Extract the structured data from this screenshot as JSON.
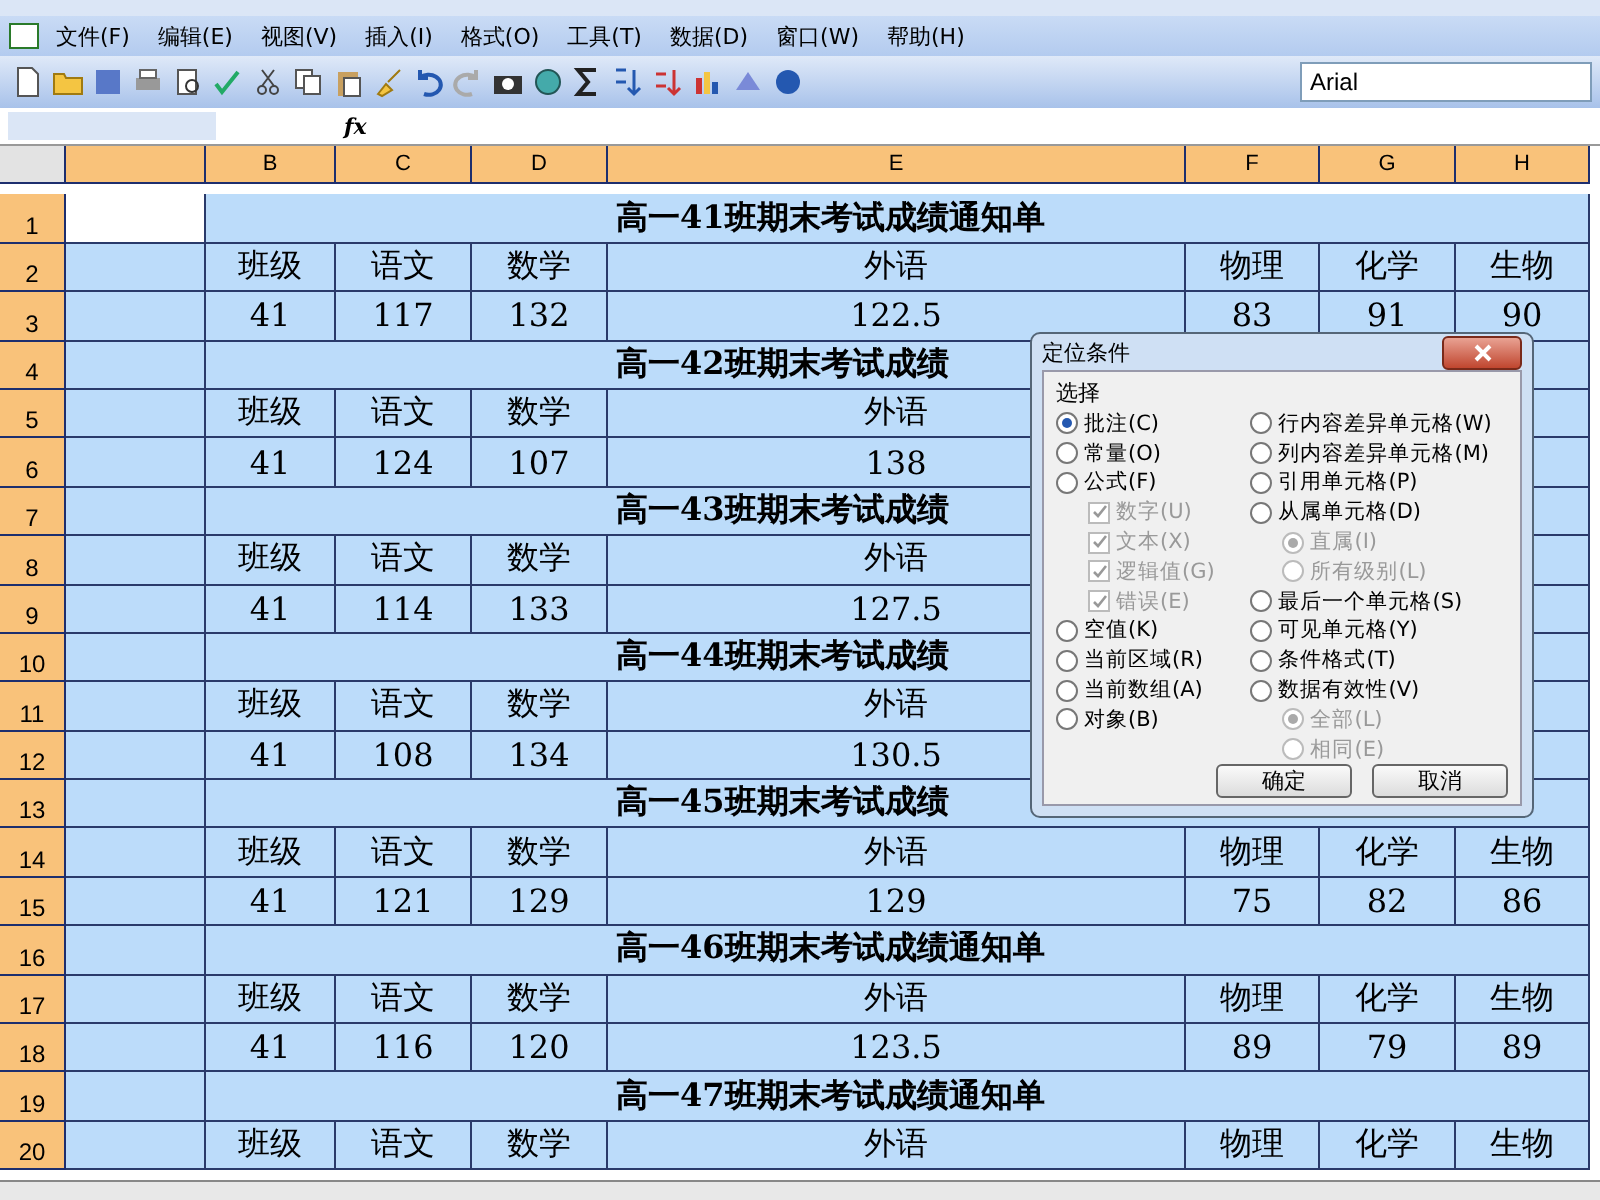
{
  "menu": [
    "文件(F)",
    "编辑(E)",
    "视图(V)",
    "插入(I)",
    "格式(O)",
    "工具(T)",
    "数据(D)",
    "窗口(W)",
    "帮助(H)"
  ],
  "font_box": {
    "value": "Arial"
  },
  "formula_bar": {
    "label": "fx"
  },
  "sheet": {
    "columns": [
      "B",
      "C",
      "D",
      "E",
      "F",
      "G",
      "H"
    ],
    "rows": [
      {
        "number": "1",
        "title": "高一41班期末考试成绩通知单"
      },
      {
        "number": "2",
        "cells": [
          "班级",
          "语文",
          "数学",
          "外语",
          "物理",
          "化学",
          "生物"
        ]
      },
      {
        "number": "3",
        "cells": [
          "41",
          "117",
          "132",
          "122.5",
          "83",
          "91",
          "90"
        ]
      },
      {
        "number": "4",
        "title": "高一42班期末考试成绩"
      },
      {
        "number": "5",
        "cells": [
          "班级",
          "语文",
          "数学",
          "外语",
          null,
          null,
          null
        ]
      },
      {
        "number": "6",
        "cells": [
          "41",
          "124",
          "107",
          "138",
          null,
          null,
          null
        ]
      },
      {
        "number": "7",
        "title": "高一43班期末考试成绩"
      },
      {
        "number": "8",
        "cells": [
          "班级",
          "语文",
          "数学",
          "外语",
          null,
          null,
          null
        ]
      },
      {
        "number": "9",
        "cells": [
          "41",
          "114",
          "133",
          "127.5",
          null,
          null,
          null
        ]
      },
      {
        "number": "10",
        "title": "高一44班期末考试成绩"
      },
      {
        "number": "11",
        "cells": [
          "班级",
          "语文",
          "数学",
          "外语",
          null,
          null,
          null
        ]
      },
      {
        "number": "12",
        "cells": [
          "41",
          "108",
          "134",
          "130.5",
          null,
          null,
          null
        ]
      },
      {
        "number": "13",
        "title": "高一45班期末考试成绩"
      },
      {
        "number": "14",
        "cells": [
          "班级",
          "语文",
          "数学",
          "外语",
          "物理",
          "化学",
          "生物"
        ]
      },
      {
        "number": "15",
        "cells": [
          "41",
          "121",
          "129",
          "129",
          "75",
          "82",
          "86"
        ]
      },
      {
        "number": "16",
        "title": "高一46班期末考试成绩通知单"
      },
      {
        "number": "17",
        "cells": [
          "班级",
          "语文",
          "数学",
          "外语",
          "物理",
          "化学",
          "生物"
        ]
      },
      {
        "number": "18",
        "cells": [
          "41",
          "116",
          "120",
          "123.5",
          "89",
          "79",
          "89"
        ]
      },
      {
        "number": "19",
        "title": "高一47班期末考试成绩通知单"
      },
      {
        "number": "20",
        "cells": [
          "班级",
          "语文",
          "数学",
          "外语",
          "物理",
          "化学",
          "生物"
        ]
      }
    ]
  },
  "dialog": {
    "title": "定位条件",
    "group": "选择",
    "left": [
      {
        "kind": "radio",
        "label": "批注(C)",
        "selected": true,
        "disabled": false
      },
      {
        "kind": "radio",
        "label": "常量(O)",
        "selected": false,
        "disabled": false
      },
      {
        "kind": "radio",
        "label": "公式(F)",
        "selected": false,
        "disabled": false,
        "children": [
          {
            "kind": "checkbox",
            "label": "数字(U)",
            "checked": true,
            "disabled": true
          },
          {
            "kind": "checkbox",
            "label": "文本(X)",
            "checked": true,
            "disabled": true
          },
          {
            "kind": "checkbox",
            "label": "逻辑值(G)",
            "checked": true,
            "disabled": true
          },
          {
            "kind": "checkbox",
            "label": "错误(E)",
            "checked": true,
            "disabled": true
          }
        ]
      },
      {
        "kind": "radio",
        "label": "空值(K)",
        "selected": false,
        "disabled": false
      },
      {
        "kind": "radio",
        "label": "当前区域(R)",
        "selected": false,
        "disabled": false
      },
      {
        "kind": "radio",
        "label": "当前数组(A)",
        "selected": false,
        "disabled": false
      },
      {
        "kind": "radio",
        "label": "对象(B)",
        "selected": false,
        "disabled": false
      }
    ],
    "right": [
      {
        "kind": "radio",
        "label": "行内容差异单元格(W)",
        "selected": false,
        "disabled": false
      },
      {
        "kind": "radio",
        "label": "列内容差异单元格(M)",
        "selected": false,
        "disabled": false
      },
      {
        "kind": "radio",
        "label": "引用单元格(P)",
        "selected": false,
        "disabled": false
      },
      {
        "kind": "radio",
        "label": "从属单元格(D)",
        "selected": false,
        "disabled": false,
        "children": [
          {
            "kind": "radio",
            "label": "直属(I)",
            "selected": true,
            "disabled": true
          },
          {
            "kind": "radio",
            "label": "所有级别(L)",
            "selected": false,
            "disabled": true
          }
        ]
      },
      {
        "kind": "radio",
        "label": "最后一个单元格(S)",
        "selected": false,
        "disabled": false
      },
      {
        "kind": "radio",
        "label": "可见单元格(Y)",
        "selected": false,
        "disabled": false
      },
      {
        "kind": "radio",
        "label": "条件格式(T)",
        "selected": false,
        "disabled": false
      },
      {
        "kind": "radio",
        "label": "数据有效性(V)",
        "selected": false,
        "disabled": false,
        "children": [
          {
            "kind": "radio",
            "label": "全部(L)",
            "selected": true,
            "disabled": true
          },
          {
            "kind": "radio",
            "label": "相同(E)",
            "selected": false,
            "disabled": true
          }
        ]
      }
    ],
    "buttons": [
      "确定",
      "取消"
    ]
  }
}
